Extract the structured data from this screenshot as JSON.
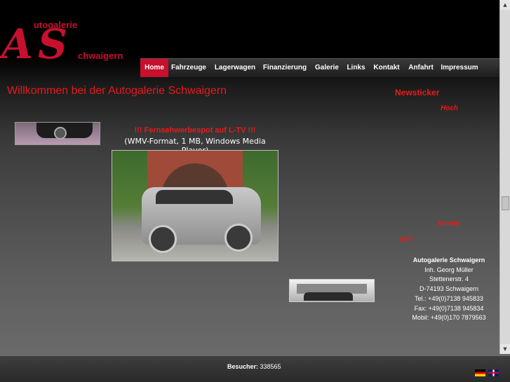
{
  "logo": {
    "line1": "utogalerie",
    "line2": "chwaigern",
    "big_a": "A",
    "big_s": "S"
  },
  "nav": {
    "items": [
      {
        "label": "Home",
        "active": true
      },
      {
        "label": "Fahrzeuge"
      },
      {
        "label": "Lagerwagen"
      },
      {
        "label": "Finanzierung"
      },
      {
        "label": "Galerie"
      },
      {
        "label": "Links"
      },
      {
        "label": "Kontakt"
      },
      {
        "label": "Anfahrt"
      },
      {
        "label": "Impressum"
      }
    ]
  },
  "main": {
    "welcome": "Willkommen bei der Autogalerie Schwaigern",
    "tv_spot": "!!! Fernsehwerbespot auf L-TV !!!",
    "format": "(WMV-Format, 1 MB, Windows Media Player)"
  },
  "sidebar": {
    "newsticker": "Newsticker",
    "ticker_top": "Hoch",
    "ticker_mid": "Kenter",
    "ticker_info": "Info"
  },
  "address": {
    "name": "Autogalerie Schwaigern",
    "owner": "Inh. Georg Müller",
    "street": "Stettenerstr. 4",
    "city": "D-74193 Schwaigern",
    "tel": "Tel.: +49(0)7138 945833",
    "fax": "Fax: +49(0)7138 945834",
    "mobil": "Mobil: +49(0)170 7879563"
  },
  "footer": {
    "visitors_label": "Besucher:",
    "visitors_count": "338565"
  },
  "colors": {
    "accent": "#e81a1a",
    "nav_active": "#c8102e"
  },
  "icons": {
    "flag_de": "german-flag-icon",
    "flag_uk": "uk-flag-icon"
  }
}
